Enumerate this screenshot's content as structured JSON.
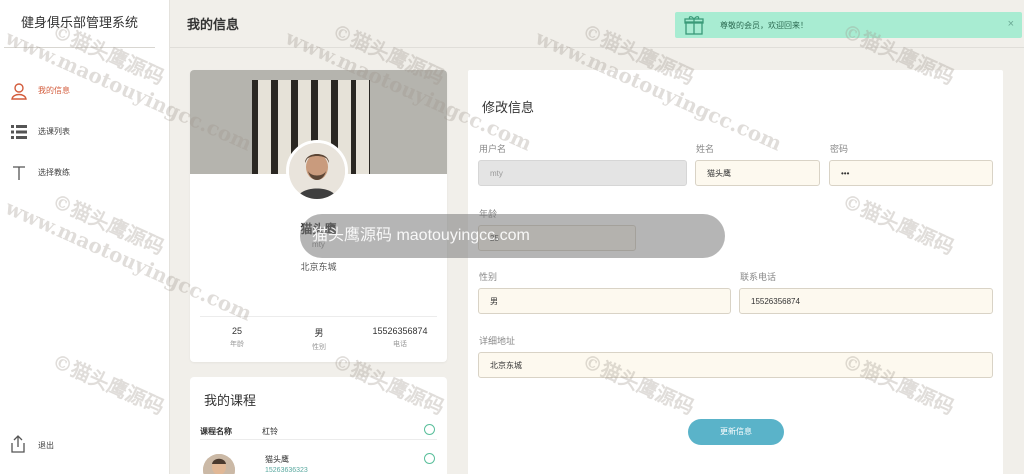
{
  "app": {
    "title": "健身俱乐部管理系统"
  },
  "sidebar": {
    "items": [
      {
        "label": "我的信息",
        "icon": "user-icon",
        "active": true
      },
      {
        "label": "选课列表",
        "icon": "list-icon",
        "active": false
      },
      {
        "label": "选择教练",
        "icon": "text-t-icon",
        "active": false
      }
    ],
    "logout": {
      "label": "退出",
      "icon": "share-icon"
    }
  },
  "header": {
    "title": "我的信息",
    "toast": {
      "message": "尊敬的会员，欢迎回来！",
      "close": "×",
      "icon": "gift-icon",
      "color": "#a8ecd2"
    }
  },
  "profile": {
    "name": "猫头鹰",
    "username": "mty",
    "address": "北京东城",
    "stats": [
      {
        "value": "25",
        "label": "年龄"
      },
      {
        "value": "男",
        "label": "性别"
      },
      {
        "value": "15526356874",
        "label": "电话"
      }
    ]
  },
  "courses": {
    "title": "我的课程",
    "header_name": "课程名称",
    "header_value": "杠铃",
    "coach_name": "猫头鹰",
    "coach_phone": "15263636323"
  },
  "form": {
    "title": "修改信息",
    "username_label": "用户名",
    "username_value": "mty",
    "name_label": "姓名",
    "name_value": "猫头鹰",
    "password_label": "密码",
    "password_value": "•••",
    "age_label": "年龄",
    "age_value": "25",
    "gender_label": "性别",
    "gender_value": "男",
    "phone_label": "联系电话",
    "phone_value": "15526356874",
    "address_label": "详细地址",
    "address_value": "北京东城",
    "submit_label": "更新信息"
  },
  "watermark": {
    "line1": "©猫头鹰源码",
    "line2": "www.maotouyingcc.com",
    "pill": "猫头鹰源码 maotouyingcc.com"
  },
  "colors": {
    "accent": "#d35c3c",
    "button": "#5ab3c9",
    "input_bg": "#fdf9ef"
  }
}
